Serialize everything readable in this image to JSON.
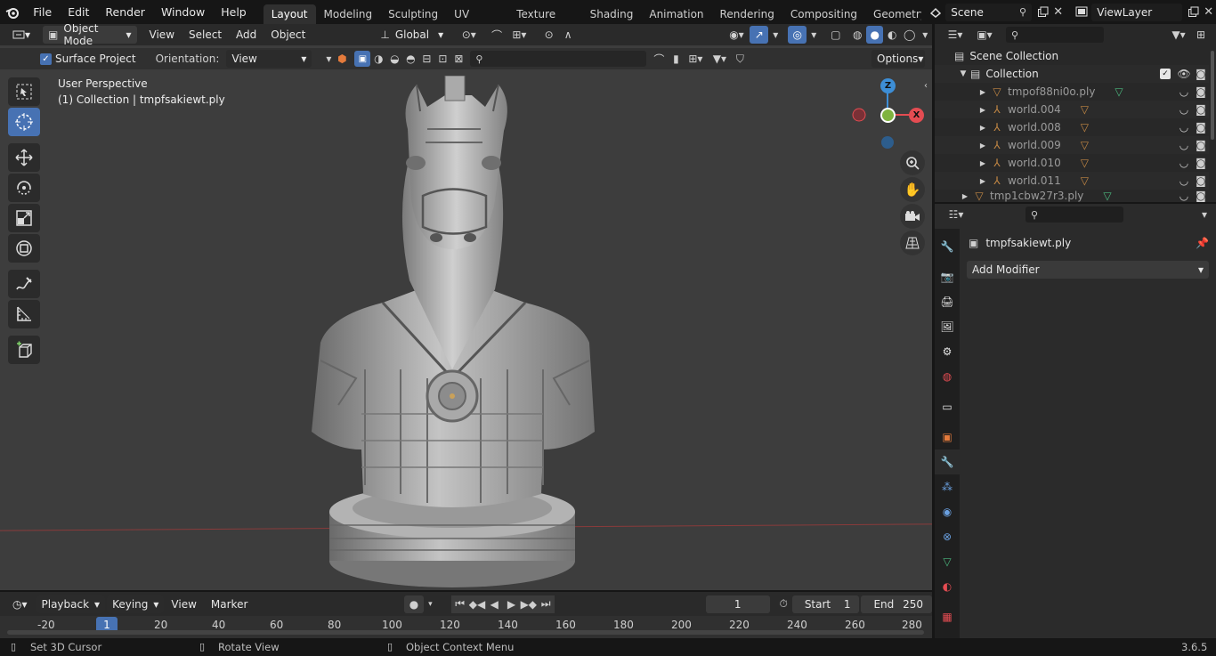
{
  "topbar": {
    "menus": [
      "File",
      "Edit",
      "Render",
      "Window",
      "Help"
    ],
    "workspaces": [
      "Layout",
      "Modeling",
      "Sculpting",
      "UV Editing",
      "Texture Paint",
      "Shading",
      "Animation",
      "Rendering",
      "Compositing",
      "Geometry Noc"
    ],
    "active_workspace": "Layout",
    "scene": "Scene",
    "view_layer": "ViewLayer"
  },
  "viewport": {
    "mode": "Object Mode",
    "menus": [
      "View",
      "Select",
      "Add",
      "Object"
    ],
    "transform_orientation": "Global",
    "surface_project_label": "Surface Project",
    "orientation_label": "Orientation:",
    "orientation_value": "View",
    "options_label": "Options",
    "view_title": "User Perspective",
    "view_subtitle": "(1) Collection | tmpfsakiewt.ply",
    "axis_x": "X",
    "axis_y": "Y",
    "axis_z": "Z"
  },
  "outliner": {
    "scene_collection": "Scene Collection",
    "collection": "Collection",
    "items": [
      {
        "name": "tmpof88ni0o.ply",
        "kind": "mesh"
      },
      {
        "name": "world.004",
        "kind": "empty"
      },
      {
        "name": "world.008",
        "kind": "empty"
      },
      {
        "name": "world.009",
        "kind": "empty"
      },
      {
        "name": "world.010",
        "kind": "empty"
      },
      {
        "name": "world.011",
        "kind": "empty"
      },
      {
        "name": "tmp1cbw27r3.ply",
        "kind": "mesh"
      }
    ]
  },
  "properties": {
    "object_name": "tmpfsakiewt.ply",
    "add_modifier_label": "Add Modifier"
  },
  "timeline": {
    "menus": [
      "Playback",
      "Keying",
      "View",
      "Marker"
    ],
    "current_frame": "1",
    "start_label": "Start",
    "start_value": "1",
    "end_label": "End",
    "end_value": "250",
    "ruler": [
      "-20",
      "1",
      "20",
      "40",
      "60",
      "80",
      "100",
      "120",
      "140",
      "160",
      "180",
      "200",
      "220",
      "240",
      "260",
      "280"
    ]
  },
  "statusbar": {
    "hint1": "Set 3D Cursor",
    "hint2": "Rotate View",
    "hint3": "Object Context Menu",
    "version": "3.6.5"
  },
  "colors": {
    "accent": "#4772b3",
    "axis_x": "#e44c52",
    "axis_y": "#7fb33e",
    "axis_z": "#3d8ed6",
    "empty_icon": "#c48844",
    "mesh_icon": "#4cb87e"
  }
}
